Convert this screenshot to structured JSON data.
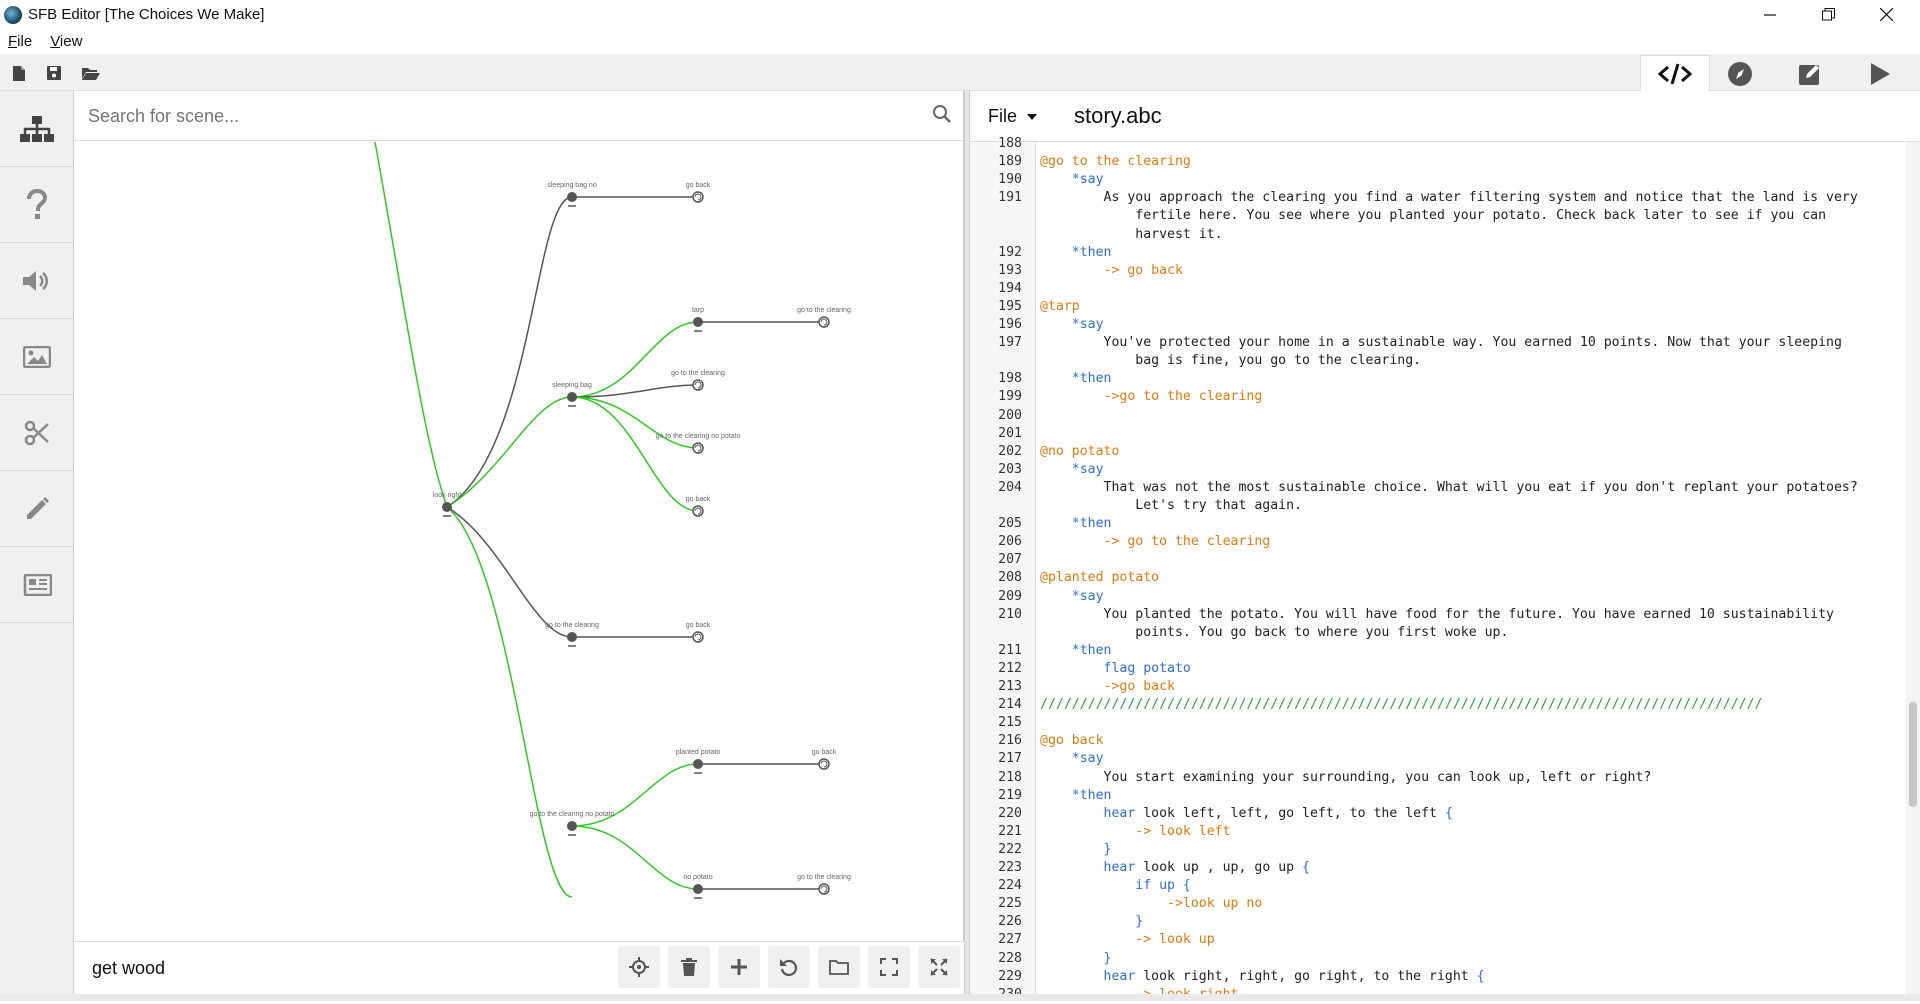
{
  "window": {
    "title": "SFB Editor [The Choices We Make]"
  },
  "menu": {
    "file": "File",
    "view": "View"
  },
  "sidebar": {
    "items": [
      "scene-tree",
      "help",
      "sound",
      "image",
      "cut",
      "edit",
      "news"
    ]
  },
  "search": {
    "placeholder": "Search for scene..."
  },
  "graph": {
    "edges": [
      {
        "from": "look right",
        "to": "sleeping bag no",
        "color": "#555555"
      },
      {
        "from": "look right",
        "to": "sleeping bag",
        "color": "#2ecc1f"
      },
      {
        "from": "look right",
        "to": "go to the clearing",
        "color": "#555555"
      },
      {
        "from": "look right",
        "to": "go to the clearing no potato",
        "color": "#2ecc1f"
      },
      {
        "from": "sleeping bag no",
        "to": "go back",
        "color": "#555555"
      },
      {
        "from": "sleeping bag",
        "to": "tarp",
        "color": "#2ecc1f"
      },
      {
        "from": "sleeping bag",
        "to": "go to the clearing",
        "color": "#555555"
      },
      {
        "from": "sleeping bag",
        "to": "go to the clearing no potato",
        "color": "#2ecc1f"
      },
      {
        "from": "sleeping bag",
        "to": "go back",
        "color": "#2ecc1f"
      },
      {
        "from": "tarp",
        "to": "go to the clearing",
        "color": "#555555"
      },
      {
        "from": "go to the clearing",
        "to": "go back",
        "color": "#555555"
      },
      {
        "from": "go to the clearing no potato",
        "to": "planted potato",
        "color": "#2ecc1f"
      },
      {
        "from": "go to the clearing no potato",
        "to": "no potato",
        "color": "#2ecc1f"
      },
      {
        "from": "planted potato",
        "to": "go back",
        "color": "#555555"
      },
      {
        "from": "no potato",
        "to": "go to the clearing",
        "color": "#555555"
      }
    ],
    "labels": {
      "look_right": "look right",
      "sleeping_bag_no": "sleeping bag no",
      "go_back_1": "go back",
      "tarp": "tarp",
      "clearing_1": "go to the clearing",
      "sleeping_bag": "sleeping bag",
      "clearing_2": "go to the clearing",
      "clearing_no_potato_1": "go to the clearing no potato",
      "go_back_2": "go back",
      "clearing_3": "go to the clearing",
      "go_back_3": "go back",
      "planted_potato": "planted potato",
      "go_back_4": "go back",
      "clearing_no_potato_2": "go to the clearing no potato",
      "no_potato": "no potato",
      "clearing_4": "go to the clearing"
    }
  },
  "bottombar": {
    "scene_name": "get wood"
  },
  "editor": {
    "file_menu": "File",
    "filename": "story.abc",
    "lines": [
      {
        "n": "188",
        "parts": [
          {
            "t": "",
            "c": "txt"
          }
        ]
      },
      {
        "n": "189",
        "parts": [
          {
            "t": "@go to the clearing",
            "c": "kw-scene"
          }
        ]
      },
      {
        "n": "190",
        "parts": [
          {
            "t": "    *say",
            "c": "kw-cmd"
          }
        ]
      },
      {
        "n": "191",
        "parts": [
          {
            "t": "        As you approach the clearing you find a water filtering system and notice that the land is very",
            "c": "txt"
          }
        ]
      },
      {
        "n": "",
        "parts": [
          {
            "t": "            fertile here. You see where you planted your potato. Check back later to see if you can",
            "c": "txt"
          }
        ]
      },
      {
        "n": "",
        "parts": [
          {
            "t": "            harvest it.",
            "c": "txt"
          }
        ]
      },
      {
        "n": "192",
        "parts": [
          {
            "t": "    *then",
            "c": "kw-cmd"
          }
        ]
      },
      {
        "n": "193",
        "parts": [
          {
            "t": "        -> go back",
            "c": "kw-arrow"
          }
        ]
      },
      {
        "n": "194",
        "parts": [
          {
            "t": "",
            "c": "txt"
          }
        ]
      },
      {
        "n": "195",
        "parts": [
          {
            "t": "@tarp",
            "c": "kw-scene"
          }
        ]
      },
      {
        "n": "196",
        "parts": [
          {
            "t": "    *say",
            "c": "kw-cmd"
          }
        ]
      },
      {
        "n": "197",
        "parts": [
          {
            "t": "        You've protected your home in a sustainable way. You earned 10 points. Now that your sleeping",
            "c": "txt"
          }
        ]
      },
      {
        "n": "",
        "parts": [
          {
            "t": "            bag is fine, you go to the clearing.",
            "c": "txt"
          }
        ]
      },
      {
        "n": "198",
        "parts": [
          {
            "t": "    *then",
            "c": "kw-cmd"
          }
        ]
      },
      {
        "n": "199",
        "parts": [
          {
            "t": "        ->go to the clearing",
            "c": "kw-arrow"
          }
        ]
      },
      {
        "n": "200",
        "parts": [
          {
            "t": "",
            "c": "txt"
          }
        ]
      },
      {
        "n": "201",
        "parts": [
          {
            "t": "",
            "c": "txt"
          }
        ]
      },
      {
        "n": "202",
        "parts": [
          {
            "t": "@no potato",
            "c": "kw-scene"
          }
        ]
      },
      {
        "n": "203",
        "parts": [
          {
            "t": "    *say",
            "c": "kw-cmd"
          }
        ]
      },
      {
        "n": "204",
        "parts": [
          {
            "t": "        That was not the most sustainable choice. What will you eat if you don't replant your potatoes?",
            "c": "txt"
          }
        ]
      },
      {
        "n": "",
        "parts": [
          {
            "t": "            Let's try that again.",
            "c": "txt"
          }
        ]
      },
      {
        "n": "205",
        "parts": [
          {
            "t": "    *then",
            "c": "kw-cmd"
          }
        ]
      },
      {
        "n": "206",
        "parts": [
          {
            "t": "        -> go to the clearing",
            "c": "kw-arrow"
          }
        ]
      },
      {
        "n": "207",
        "parts": [
          {
            "t": "",
            "c": "txt"
          }
        ]
      },
      {
        "n": "208",
        "parts": [
          {
            "t": "@planted potato",
            "c": "kw-scene"
          }
        ]
      },
      {
        "n": "209",
        "parts": [
          {
            "t": "    *say",
            "c": "kw-cmd"
          }
        ]
      },
      {
        "n": "210",
        "parts": [
          {
            "t": "        You planted the potato. You will have food for the future. You have earned 10 sustainability",
            "c": "txt"
          }
        ]
      },
      {
        "n": "",
        "parts": [
          {
            "t": "            points. You go back to where you first woke up.",
            "c": "txt"
          }
        ]
      },
      {
        "n": "211",
        "parts": [
          {
            "t": "    *then",
            "c": "kw-cmd"
          }
        ]
      },
      {
        "n": "212",
        "parts": [
          {
            "t": "        flag potato",
            "c": "kw-cmd"
          }
        ]
      },
      {
        "n": "213",
        "parts": [
          {
            "t": "        ->go back",
            "c": "kw-arrow"
          }
        ]
      },
      {
        "n": "214",
        "parts": [
          {
            "t": "///////////////////////////////////////////////////////////////////////////////////////////",
            "c": "kw-comment"
          }
        ]
      },
      {
        "n": "215",
        "parts": [
          {
            "t": "",
            "c": "txt"
          }
        ]
      },
      {
        "n": "216",
        "parts": [
          {
            "t": "@go back",
            "c": "kw-scene"
          }
        ]
      },
      {
        "n": "217",
        "parts": [
          {
            "t": "    *say",
            "c": "kw-cmd"
          }
        ]
      },
      {
        "n": "218",
        "parts": [
          {
            "t": "        You start examining your surrounding, you can look up, left or right?",
            "c": "txt"
          }
        ]
      },
      {
        "n": "219",
        "parts": [
          {
            "t": "    *then",
            "c": "kw-cmd"
          }
        ]
      },
      {
        "n": "220",
        "parts": [
          {
            "t": "        hear",
            "c": "kw-cmd"
          },
          {
            "t": " look left, left, go left, to the left ",
            "c": "txt"
          },
          {
            "t": "{",
            "c": "kw-cmd"
          }
        ]
      },
      {
        "n": "221",
        "parts": [
          {
            "t": "            -> look left",
            "c": "kw-arrow"
          }
        ]
      },
      {
        "n": "222",
        "parts": [
          {
            "t": "        }",
            "c": "kw-cmd"
          }
        ]
      },
      {
        "n": "223",
        "parts": [
          {
            "t": "        hear",
            "c": "kw-cmd"
          },
          {
            "t": " look up , up, go up ",
            "c": "txt"
          },
          {
            "t": "{",
            "c": "kw-cmd"
          }
        ]
      },
      {
        "n": "224",
        "parts": [
          {
            "t": "            if up {",
            "c": "kw-cmd"
          }
        ]
      },
      {
        "n": "225",
        "parts": [
          {
            "t": "                ->look up no",
            "c": "kw-arrow"
          }
        ]
      },
      {
        "n": "226",
        "parts": [
          {
            "t": "            }",
            "c": "kw-cmd"
          }
        ]
      },
      {
        "n": "227",
        "parts": [
          {
            "t": "            -> look up",
            "c": "kw-arrow"
          }
        ]
      },
      {
        "n": "228",
        "parts": [
          {
            "t": "        }",
            "c": "kw-cmd"
          }
        ]
      },
      {
        "n": "229",
        "parts": [
          {
            "t": "        hear",
            "c": "kw-cmd"
          },
          {
            "t": " look right, right, go right, to the right ",
            "c": "txt"
          },
          {
            "t": "{",
            "c": "kw-cmd"
          }
        ]
      },
      {
        "n": "230",
        "parts": [
          {
            "t": "            -> look right",
            "c": "kw-arrow"
          }
        ]
      }
    ]
  }
}
